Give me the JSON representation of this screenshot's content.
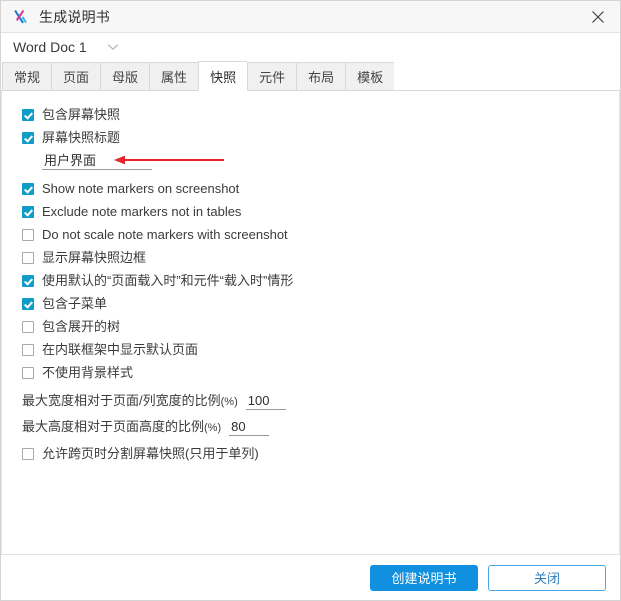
{
  "window": {
    "title": "生成说明书",
    "app_icon": "axure-x-icon",
    "close_icon": "close-icon"
  },
  "doc_selector": {
    "value": "Word Doc 1",
    "caret_icon": "chevron-down-icon"
  },
  "tabs": [
    {
      "label": "常规",
      "active": false
    },
    {
      "label": "页面",
      "active": false
    },
    {
      "label": "母版",
      "active": false
    },
    {
      "label": "属性",
      "active": false
    },
    {
      "label": "快照",
      "active": true
    },
    {
      "label": "元件",
      "active": false
    },
    {
      "label": "布局",
      "active": false
    },
    {
      "label": "模板",
      "active": false
    }
  ],
  "options": [
    {
      "label": "包含屏幕快照",
      "checked": true
    },
    {
      "label": "屏幕快照标题",
      "checked": true
    },
    {
      "label": "Show note markers on screenshot",
      "checked": true
    },
    {
      "label": "Exclude note markers not in tables",
      "checked": true
    },
    {
      "label": "Do not scale note markers with screenshot",
      "checked": false
    },
    {
      "label": "显示屏幕快照边框",
      "checked": false
    },
    {
      "label": "使用默认的“页面载入时”和元件“载入时”情形",
      "checked": true
    },
    {
      "label": "包含子菜单",
      "checked": true
    },
    {
      "label": "包含展开的树",
      "checked": false
    },
    {
      "label": "在内联框架中显示默认页面",
      "checked": false
    },
    {
      "label": "不使用背景样式",
      "checked": false
    },
    {
      "label": "允许跨页时分割屏幕快照(只用于单列)",
      "checked": false
    }
  ],
  "title_field": {
    "value": "用户界面",
    "placeholder": "",
    "annotation_icon": "red-left-arrow-icon"
  },
  "max_width": {
    "label": "最大宽度相对于页面/列宽度的比例",
    "unit": "(%)",
    "value": "100"
  },
  "max_height": {
    "label": "最大高度相对于页面高度的比例",
    "unit": "(%)",
    "value": "80"
  },
  "footer": {
    "primary_label": "创建说明书",
    "secondary_label": "关闭"
  },
  "colors": {
    "accent_blue": "#1090df",
    "checkbox_teal": "#0f9dc8",
    "annotation_red": "#e8262a",
    "secondary_border": "#4aa8e4"
  }
}
